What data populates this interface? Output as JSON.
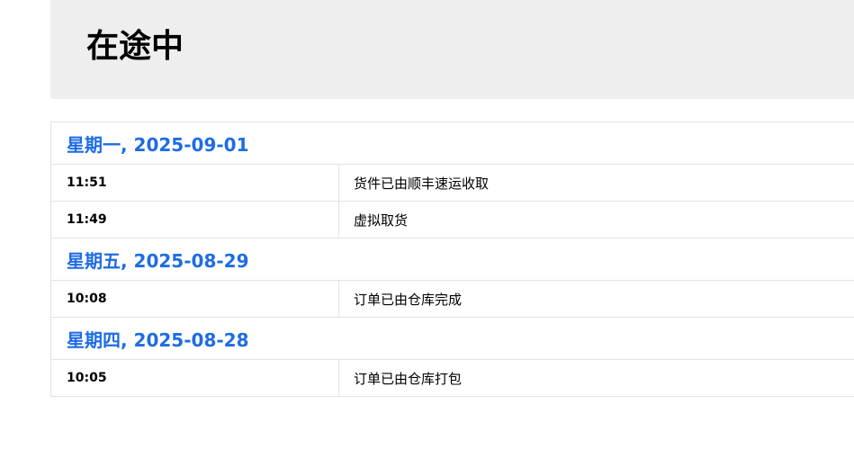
{
  "status": {
    "title": "在途中"
  },
  "timeline": [
    {
      "date": "星期一, 2025-09-01",
      "events": [
        {
          "time": "11:51",
          "description": "货件已由顺丰速运收取"
        },
        {
          "time": "11:49",
          "description": "虚拟取货"
        }
      ]
    },
    {
      "date": "星期五, 2025-08-29",
      "events": [
        {
          "time": "10:08",
          "description": "订单已由仓库完成"
        }
      ]
    },
    {
      "date": "星期四, 2025-08-28",
      "events": [
        {
          "time": "10:05",
          "description": "订单已由仓库打包"
        }
      ]
    }
  ],
  "colors": {
    "date_text": "#1e6ce3",
    "header_bg": "#eeeeee",
    "border": "#e3e3e3"
  }
}
